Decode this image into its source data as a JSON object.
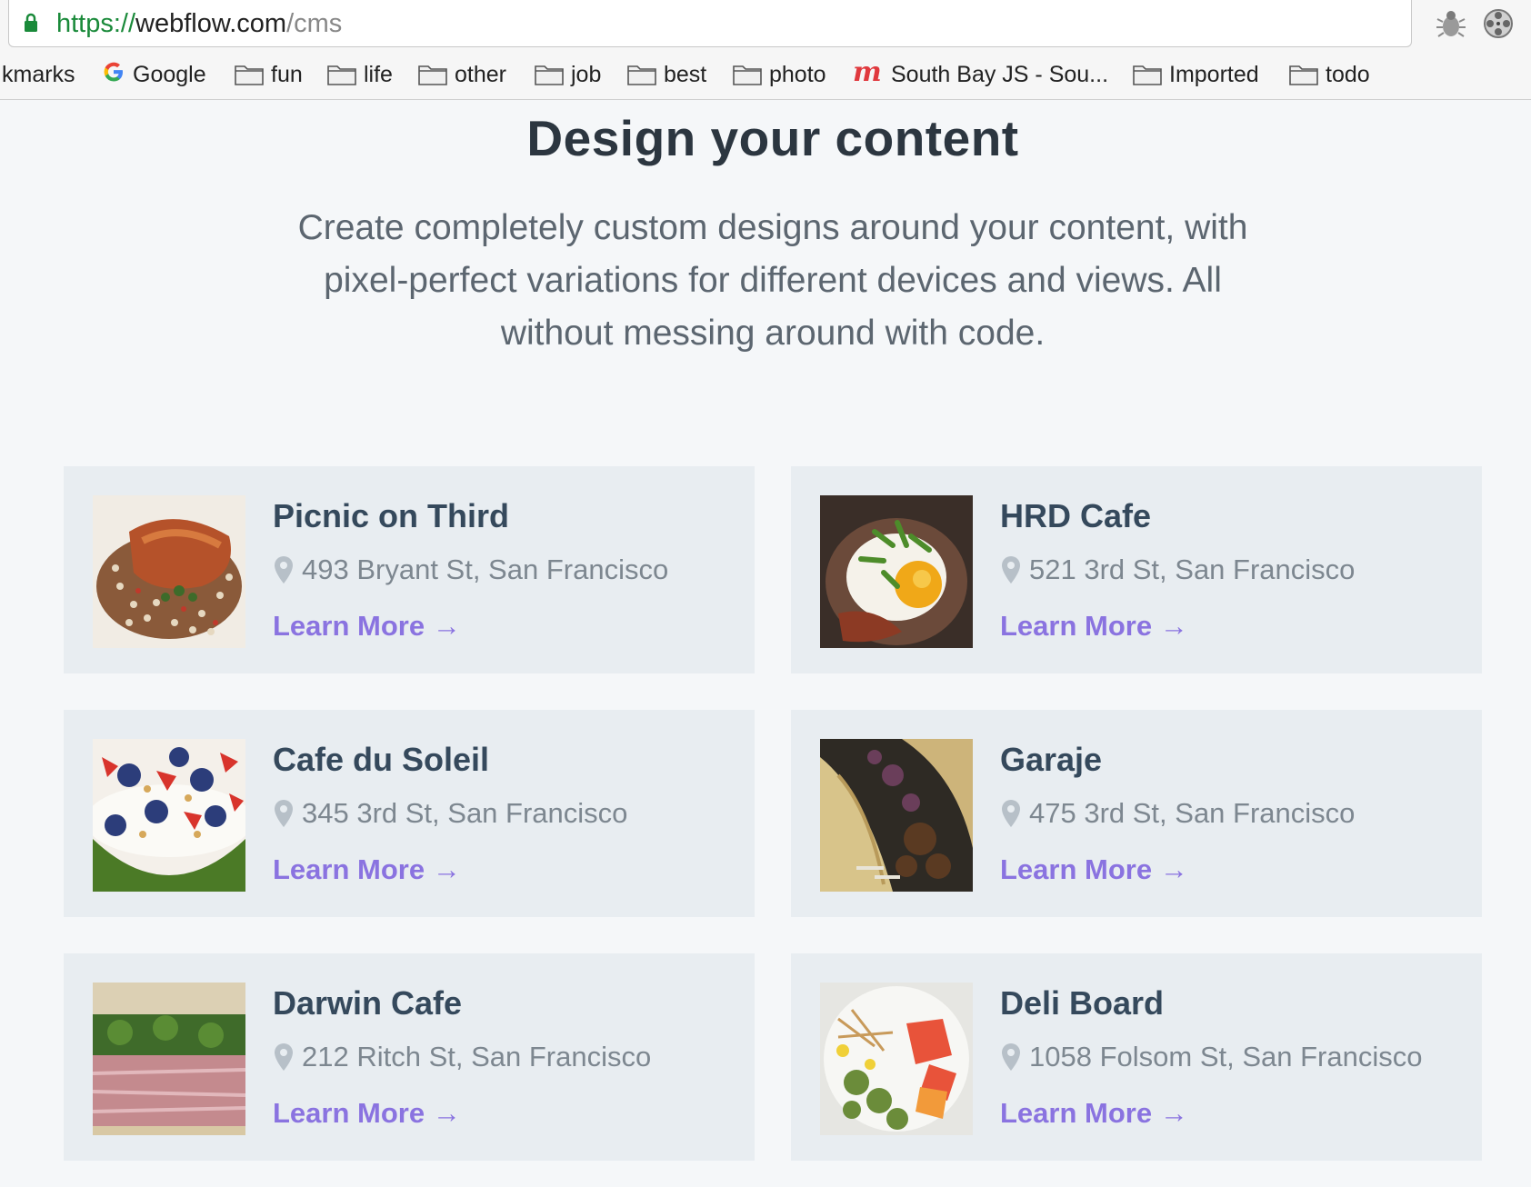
{
  "browser": {
    "url_scheme": "https://",
    "url_host": "webflow.com",
    "url_path": "/cms",
    "bookmarks": [
      {
        "label": "kmarks",
        "icon": "none"
      },
      {
        "label": "Google",
        "icon": "google-icon"
      },
      {
        "label": "fun",
        "icon": "folder-icon"
      },
      {
        "label": "life",
        "icon": "folder-icon"
      },
      {
        "label": "other",
        "icon": "folder-icon"
      },
      {
        "label": "job",
        "icon": "folder-icon"
      },
      {
        "label": "best",
        "icon": "folder-icon"
      },
      {
        "label": "photo",
        "icon": "folder-icon"
      },
      {
        "label": "South Bay JS - Sou...",
        "icon": "meetup-icon"
      },
      {
        "label": "Imported",
        "icon": "folder-icon"
      },
      {
        "label": "todo",
        "icon": "folder-icon"
      }
    ]
  },
  "hero": {
    "title": "Design your content",
    "subtitle_line1": "Create completely custom designs around your content, with",
    "subtitle_line2": "pixel-perfect variations for different devices and views. All",
    "subtitle_line3": "without messing around with code."
  },
  "cards": [
    {
      "name": "Picnic on Third",
      "address": "493 Bryant St, San Francisco",
      "link": "Learn More →",
      "image": "food-photo-fish-beans"
    },
    {
      "name": "HRD Cafe",
      "address": "521 3rd St, San Francisco",
      "link": "Learn More →",
      "image": "food-photo-egg-bowl"
    },
    {
      "name": "Cafe du Soleil",
      "address": "345 3rd St, San Francisco",
      "link": "Learn More →",
      "image": "food-photo-berry-yogurt"
    },
    {
      "name": "Garaje",
      "address": "475 3rd St, San Francisco",
      "link": "Learn More →",
      "image": "food-photo-tacos"
    },
    {
      "name": "Darwin Cafe",
      "address": "212 Ritch St, San Francisco",
      "link": "Learn More →",
      "image": "food-photo-sandwich"
    },
    {
      "name": "Deli Board",
      "address": "1058 Folsom St, San Francisco",
      "link": "Learn More →",
      "image": "food-photo-salad"
    }
  ],
  "colors": {
    "accent_link": "#8a73e0",
    "card_bg": "#e8edf1",
    "heading": "#35495c"
  }
}
